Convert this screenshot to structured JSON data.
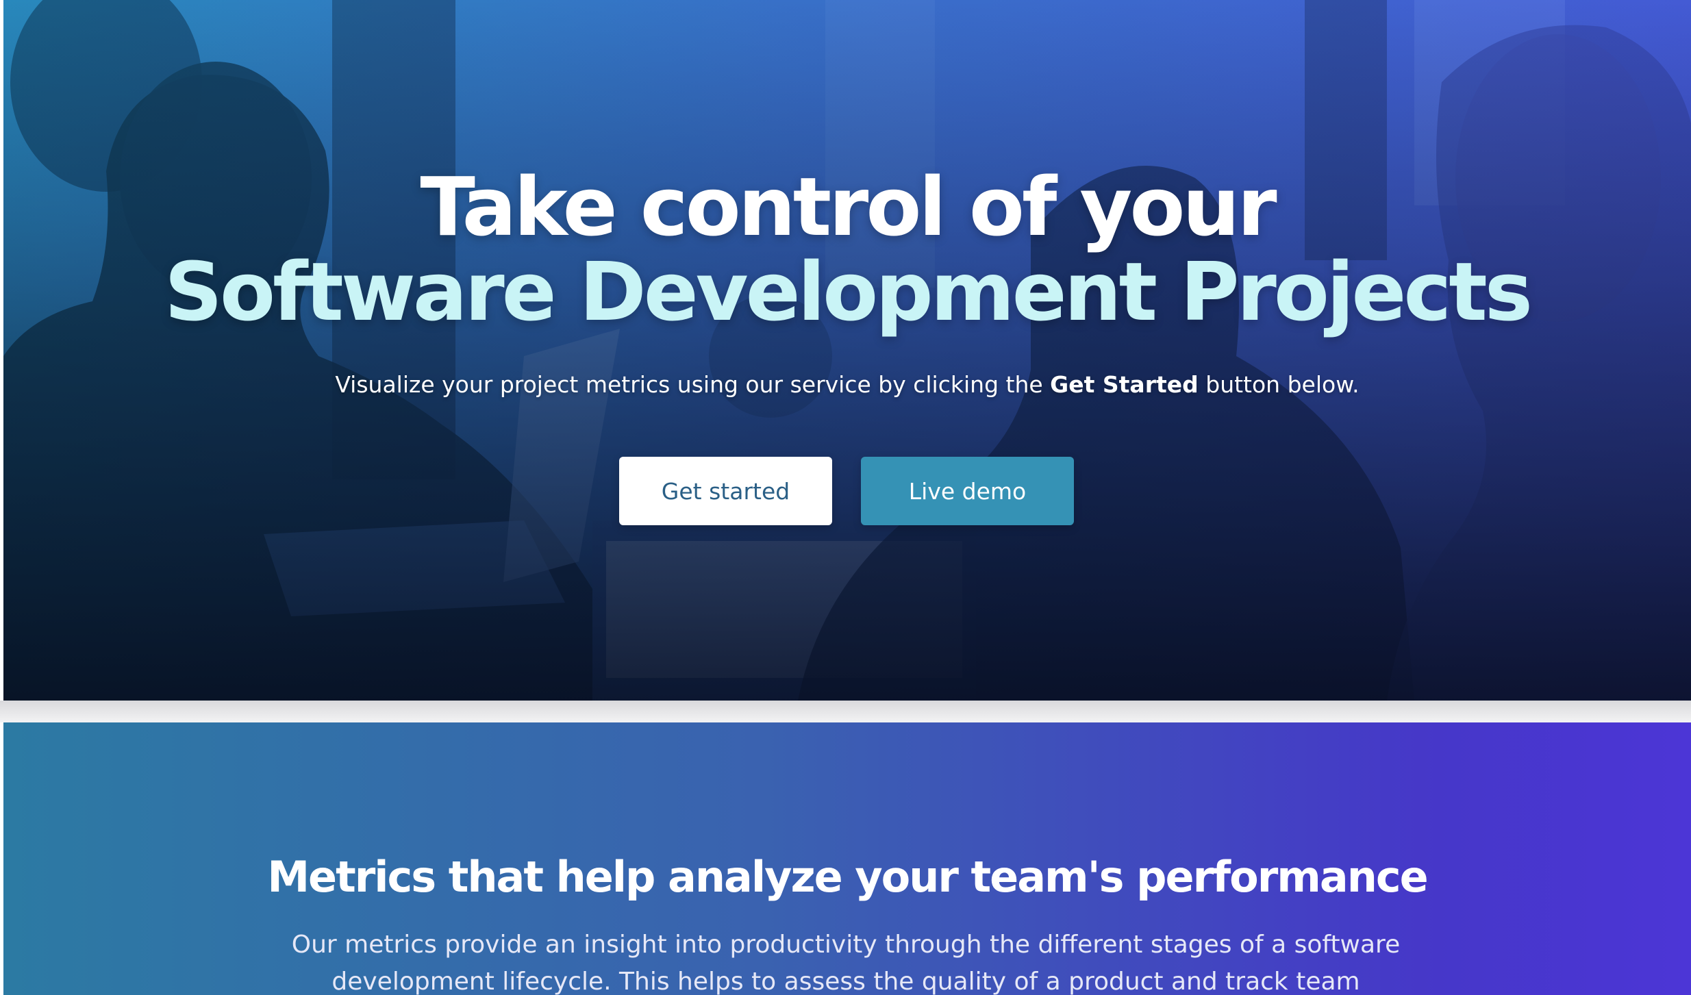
{
  "hero": {
    "title_line1": "Take control of your",
    "title_line2": "Software Development Projects",
    "subtitle_before": "Visualize your project metrics using our service by clicking the ",
    "subtitle_bold": "Get Started",
    "subtitle_after": " button below.",
    "primary_button_label": "Get started",
    "secondary_button_label": "Live demo",
    "background_image": "developers-working-on-laptops-photo"
  },
  "metrics": {
    "title": "Metrics that help analyze your team's performance",
    "body": "Our metrics provide an insight into productivity through the different stages of a software development lifecycle. This helps to assess the quality of a product and track team"
  },
  "colors": {
    "title_accent": "#c9f4f6",
    "primary_button_bg": "#ffffff",
    "primary_button_text": "#2a5f86",
    "secondary_button_bg": "#3592b5",
    "metrics_gradient_start": "#2c7aa3",
    "metrics_gradient_end": "#4c36d6"
  }
}
